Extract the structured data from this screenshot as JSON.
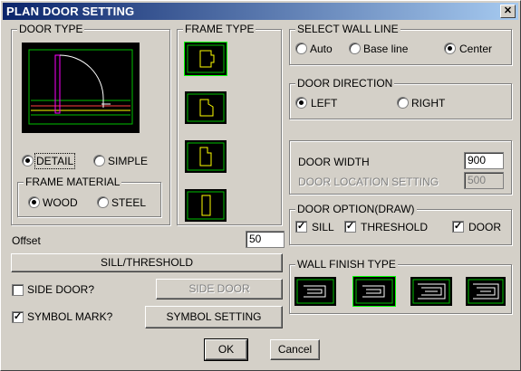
{
  "window": {
    "title": "PLAN DOOR SETTING",
    "close_glyph": "✕"
  },
  "door_type": {
    "legend": "DOOR TYPE",
    "options": [
      {
        "label": "DETAIL",
        "selected": true
      },
      {
        "label": "SIMPLE",
        "selected": false
      }
    ],
    "frame_material": {
      "legend": "FRAME MATERIAL",
      "options": [
        {
          "label": "WOOD",
          "selected": true
        },
        {
          "label": "STEEL",
          "selected": false
        }
      ]
    }
  },
  "frame_type": {
    "legend": "FRAME TYPE"
  },
  "offset": {
    "label": "Offset",
    "value": "50"
  },
  "sill_threshold_button": "SILL/THRESHOLD",
  "side_door": {
    "label": "SIDE DOOR?",
    "checked": false,
    "button": "SIDE DOOR"
  },
  "symbol_mark": {
    "label": "SYMBOL MARK?",
    "checked": true,
    "button": "SYMBOL SETTING"
  },
  "select_wall_line": {
    "legend": "SELECT WALL LINE",
    "options": [
      {
        "label": "Auto",
        "selected": false
      },
      {
        "label": "Base line",
        "selected": false
      },
      {
        "label": "Center",
        "selected": true
      }
    ]
  },
  "door_direction": {
    "legend": "DOOR DIRECTION",
    "options": [
      {
        "label": "LEFT",
        "selected": true
      },
      {
        "label": "RIGHT",
        "selected": false
      }
    ]
  },
  "door_width": {
    "label": "DOOR WIDTH",
    "value": "900"
  },
  "door_location": {
    "label": "DOOR LOCATION SETTING",
    "value": "500"
  },
  "door_option": {
    "legend": "DOOR OPTION(DRAW)",
    "options": [
      {
        "label": "SILL",
        "checked": true
      },
      {
        "label": "THRESHOLD",
        "checked": true
      },
      {
        "label": "DOOR",
        "checked": true
      }
    ]
  },
  "wall_finish_type": {
    "legend": "WALL FINISH TYPE"
  },
  "footer": {
    "ok": "OK",
    "cancel": "Cancel"
  },
  "colors": {
    "title_start": "#0a246a",
    "title_end": "#a6caf0",
    "preview_green": "#00c000",
    "preview_yellow": "#ffff00",
    "preview_magenta": "#ff00ff"
  }
}
